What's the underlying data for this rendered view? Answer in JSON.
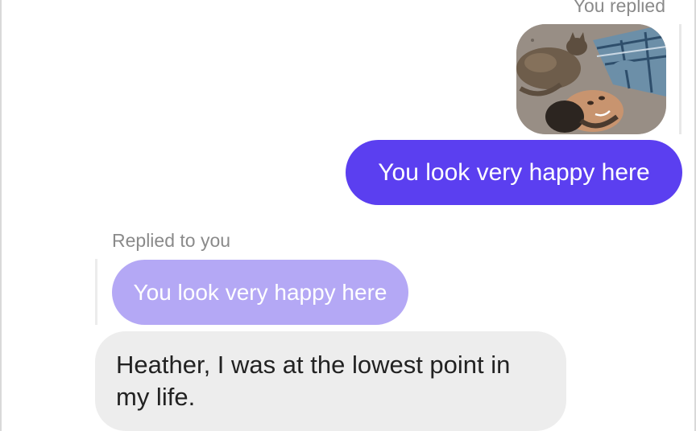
{
  "thread": {
    "outgoing_header": "You replied",
    "outgoing_message": "You look very happy here",
    "incoming_header": "Replied to you",
    "quoted_message": "You look very happy here",
    "incoming_message": "Heather, I was at the lowest point in my life."
  },
  "colors": {
    "outgoing_bubble": "#5b3ff0",
    "quoted_bubble": "#b4a8f5",
    "incoming_bubble": "#ededed",
    "meta_text": "#8a8a8a"
  }
}
